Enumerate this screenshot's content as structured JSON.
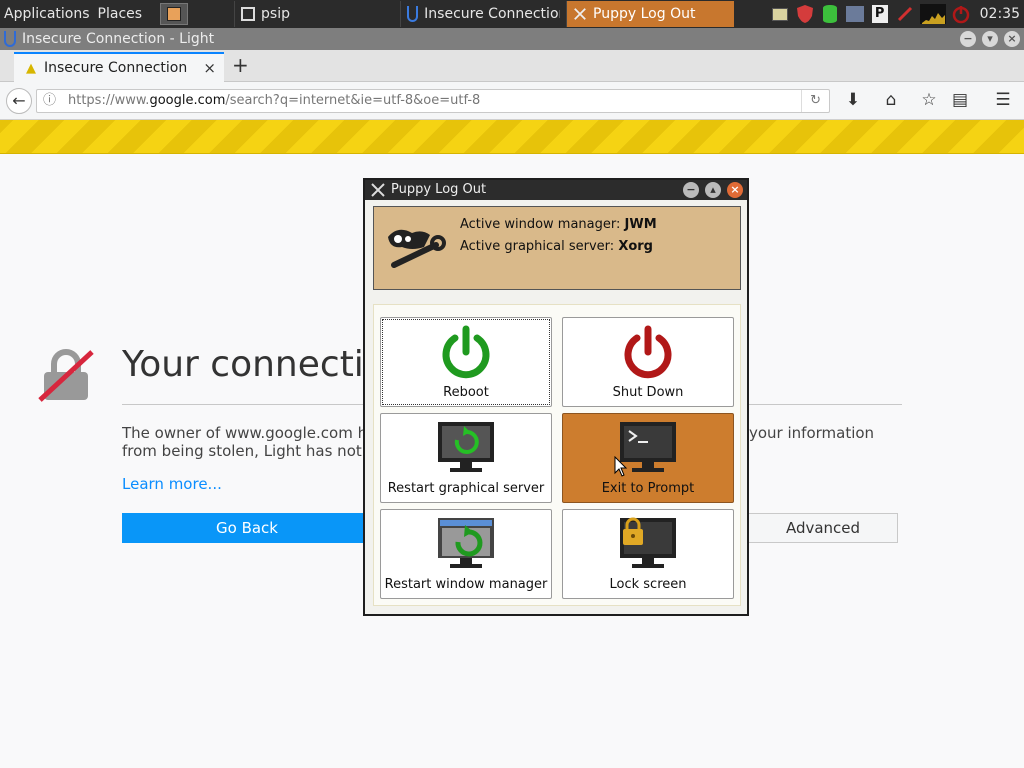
{
  "taskbar": {
    "menus": [
      "Applications",
      "Places"
    ],
    "tasks": [
      {
        "label": "psip",
        "active": false
      },
      {
        "label": "Insecure Connection -",
        "active": false
      },
      {
        "label": "Puppy Log Out",
        "active": true
      }
    ],
    "clock": "02:35",
    "tray_icons": [
      "notes-icon",
      "shield-icon",
      "database-icon",
      "network-icon",
      "p-icon",
      "pen-icon",
      "cpu-graph-icon",
      "power-icon"
    ]
  },
  "browser": {
    "window_title": "Insecure Connection - Light",
    "tab_title": "Insecure Connection",
    "tab_close": "×",
    "new_tab": "+",
    "url_prefix": "https://www.",
    "url_domain": "google.com",
    "url_suffix": "/search?q=internet&ie=utf-8&oe=utf-8",
    "error": {
      "title": "Your connection is not secure",
      "text_line1_left": "The owner of www.google.com has configured their website improperly.",
      "text_line1_right": "your information",
      "text_line2_left": "from being stolen, Light has not connected to this website.",
      "learn_more": "Learn more...",
      "go_back": "Go Back",
      "advanced": "Advanced"
    }
  },
  "dialog": {
    "title": "Puppy Log Out",
    "wm_label": "Active window manager: ",
    "wm_value": "JWM",
    "server_label": "Active graphical server: ",
    "server_value": "Xorg",
    "buttons": {
      "reboot": "Reboot",
      "shutdown": "Shut Down",
      "restart_x": "Restart graphical server",
      "exit_prompt": "Exit to Prompt",
      "restart_wm": "Restart window manager",
      "lock": "Lock screen"
    }
  },
  "colors": {
    "accent": "#0a84ff",
    "selected_tile": "#cd7d2e",
    "reboot_green": "#1f9a1f",
    "shutdown_red": "#b11818",
    "warning_yellow": "#f5d313"
  }
}
